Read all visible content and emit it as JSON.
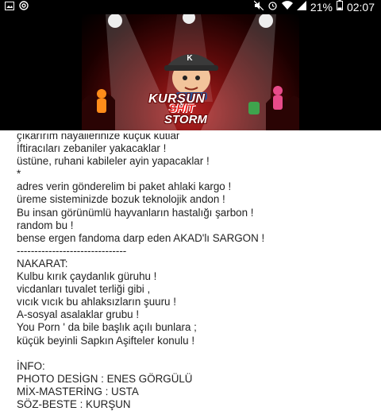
{
  "status_bar": {
    "battery": "21%",
    "time": "02:07",
    "icons": [
      "image-icon",
      "at-icon",
      "mute-icon",
      "alarm-icon",
      "wifi-icon",
      "signal-icon",
      "battery-icon"
    ]
  },
  "cover": {
    "logo_line1": "KURŞUN",
    "logo_line2": "SHIT",
    "logo_line3": "STORM",
    "cap_letter": "K",
    "colors": {
      "bg": "#000000",
      "stage": "#8c0e0e",
      "cap": "#3a3a3a"
    }
  },
  "lyrics": [
    "çıkarırım hayallerinize küçük kutlar",
    "İftiracıları zebaniler yakacaklar !",
    "üstüne, ruhani kabileler ayin yapacaklar !",
    "*",
    "adres verin gönderelim bi paket ahlaki kargo !",
    "üreme sisteminizde bozuk teknolojik andon !",
    "Bu insan görünümlü hayvanların hastalığı şarbon !",
    "random bu !",
    "bense ergen fandoma darp eden AKAD'lı SARGON !",
    "-------------------------------",
    "NAKARAT:",
    "Kulbu kırık çaydanlık güruhu !",
    "vicdanları tuvalet terliği gibi ,",
    "vıcık vıcık bu ahlaksızların şuuru !",
    "A-sosyal asalaklar grubu !",
    "You Porn ' da bile başlık açılı bunlara ;",
    "küçük beyinli Sapkın Aşifteler konulu !",
    "",
    "İNFO:",
    "PHOTO DESİGN : ENES GÖRGÜLÜ",
    "MİX-MASTERİNG : USTA",
    "SÖZ-BESTE : KURŞUN"
  ]
}
